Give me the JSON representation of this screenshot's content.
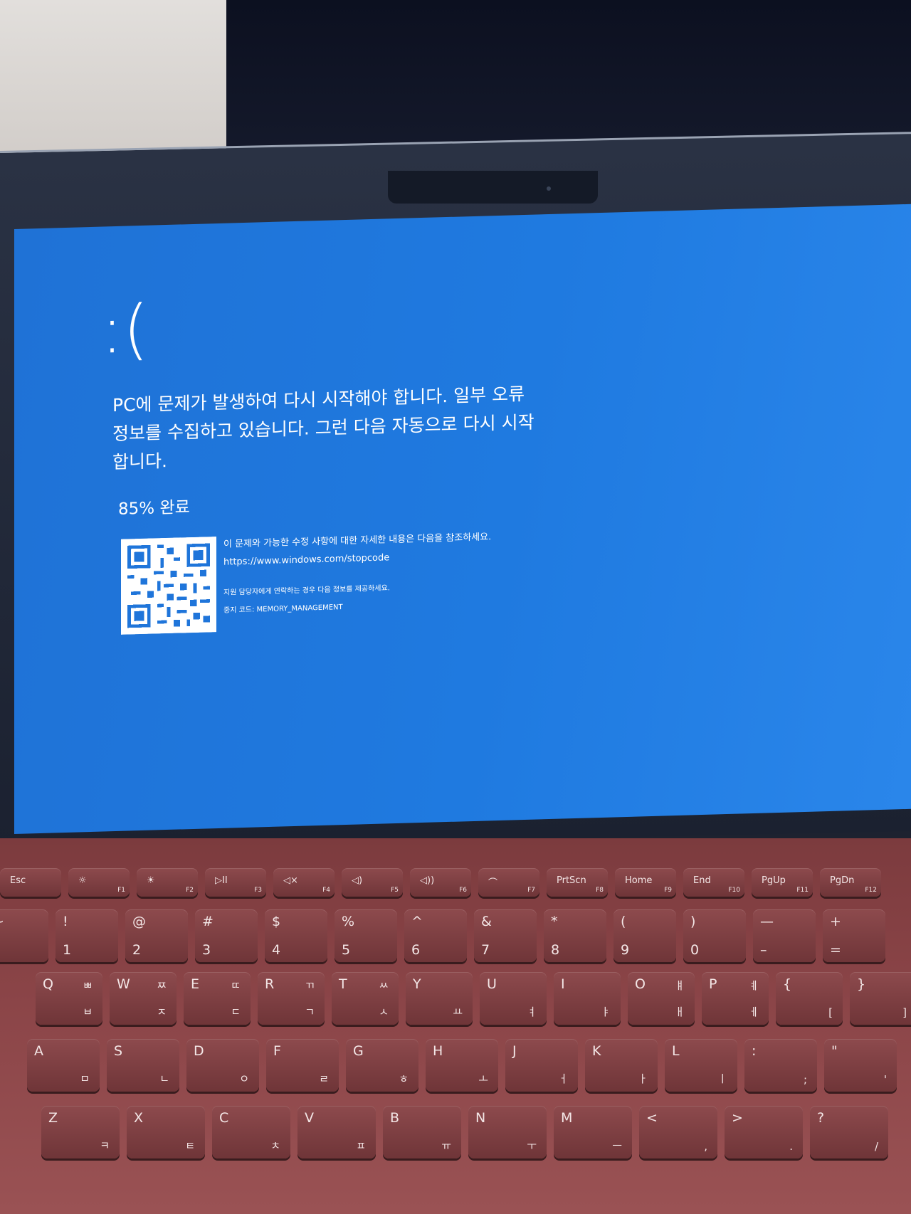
{
  "screen": {
    "frown": ":(",
    "headline": "PC에 문제가 발생하여 다시 시작해야 합니다. 일부 오류 정보를 수집하고 있습니다. 그런 다음 자동으로 다시 시작합니다.",
    "progress": "85% 완료",
    "more_info": "이 문제와 가능한 수정 사항에 대한 자세한 내용은 다음을 참조하세요.",
    "url": "https://www.windows.com/stopcode",
    "contact": "지원 담당자에게 연락하는 경우 다음 정보를 제공하세요.",
    "stop_code": "중지 코드: MEMORY_MANAGEMENT"
  },
  "keyboard": {
    "fn_row": [
      {
        "t": "Esc",
        "f": ""
      },
      {
        "t": "☼",
        "f": "F1"
      },
      {
        "t": "☀",
        "f": "F2"
      },
      {
        "t": "▷II",
        "f": "F3"
      },
      {
        "t": "◁×",
        "f": "F4"
      },
      {
        "t": "◁)",
        "f": "F5"
      },
      {
        "t": "◁))",
        "f": "F6"
      },
      {
        "t": "⌒",
        "f": "F7"
      },
      {
        "t": "PrtScn",
        "f": "F8"
      },
      {
        "t": "Home",
        "f": "F9"
      },
      {
        "t": "End",
        "f": "F10"
      },
      {
        "t": "PgUp",
        "f": "F11"
      },
      {
        "t": "PgDn",
        "f": "F12"
      }
    ],
    "num_row": [
      {
        "t": "~",
        "b": "`"
      },
      {
        "t": "!",
        "b": "1"
      },
      {
        "t": "@",
        "b": "2"
      },
      {
        "t": "#",
        "b": "3"
      },
      {
        "t": "$",
        "b": "4"
      },
      {
        "t": "%",
        "b": "5"
      },
      {
        "t": "^",
        "b": "6"
      },
      {
        "t": "&",
        "b": "7"
      },
      {
        "t": "*",
        "b": "8"
      },
      {
        "t": "(",
        "b": "9"
      },
      {
        "t": ")",
        "b": "0"
      },
      {
        "t": "—",
        "b": "–"
      },
      {
        "t": "+",
        "b": "="
      }
    ],
    "q_row": [
      {
        "t": "Q",
        "tr": "ㅃ",
        "br": "ㅂ"
      },
      {
        "t": "W",
        "tr": "ㅉ",
        "br": "ㅈ"
      },
      {
        "t": "E",
        "tr": "ㄸ",
        "br": "ㄷ"
      },
      {
        "t": "R",
        "tr": "ㄲ",
        "br": "ㄱ"
      },
      {
        "t": "T",
        "tr": "ㅆ",
        "br": "ㅅ"
      },
      {
        "t": "Y",
        "tr": "",
        "br": "ㅛ"
      },
      {
        "t": "U",
        "tr": "",
        "br": "ㅕ"
      },
      {
        "t": "I",
        "tr": "",
        "br": "ㅑ"
      },
      {
        "t": "O",
        "tr": "ㅒ",
        "br": "ㅐ"
      },
      {
        "t": "P",
        "tr": "ㅖ",
        "br": "ㅔ"
      },
      {
        "t": "{",
        "tr": "",
        "br": "["
      },
      {
        "t": "}",
        "tr": "",
        "br": "]"
      }
    ],
    "a_row": [
      {
        "t": "A",
        "br": "ㅁ"
      },
      {
        "t": "S",
        "br": "ㄴ"
      },
      {
        "t": "D",
        "br": "ㅇ"
      },
      {
        "t": "F",
        "br": "ㄹ"
      },
      {
        "t": "G",
        "br": "ㅎ"
      },
      {
        "t": "H",
        "br": "ㅗ"
      },
      {
        "t": "J",
        "br": "ㅓ"
      },
      {
        "t": "K",
        "br": "ㅏ"
      },
      {
        "t": "L",
        "br": "ㅣ"
      },
      {
        "t": ":",
        "br": ";"
      },
      {
        "t": "\"",
        "br": "'"
      }
    ],
    "z_row": [
      {
        "t": "Z",
        "br": "ㅋ"
      },
      {
        "t": "X",
        "br": "ㅌ"
      },
      {
        "t": "C",
        "br": "ㅊ"
      },
      {
        "t": "V",
        "br": "ㅍ"
      },
      {
        "t": "B",
        "br": "ㅠ"
      },
      {
        "t": "N",
        "br": "ㅜ"
      },
      {
        "t": "M",
        "br": "ㅡ"
      },
      {
        "t": "<",
        "br": ","
      },
      {
        "t": ">",
        "br": "."
      },
      {
        "t": "?",
        "br": "/"
      }
    ]
  },
  "colors": {
    "screen_blue": "#1f75da",
    "keyboard_burgundy": "#8a4447"
  }
}
